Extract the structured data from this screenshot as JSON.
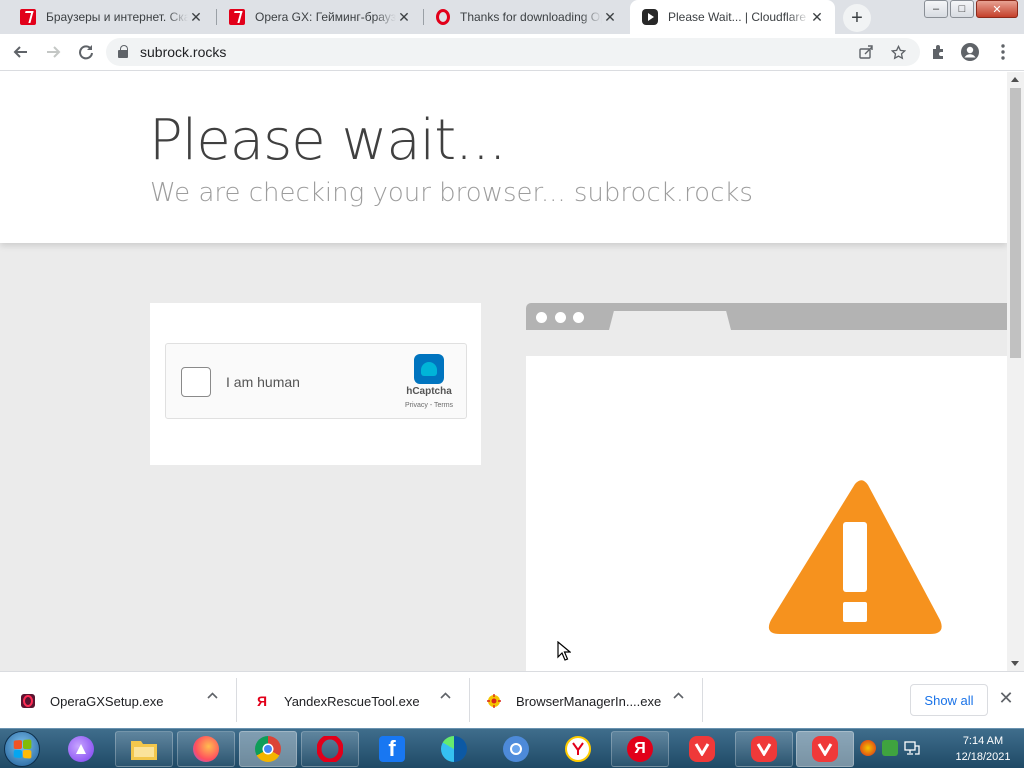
{
  "browser": {
    "tabs": [
      {
        "title": "Браузеры и интернет. Скачать",
        "favicon": "red-softportal-icon",
        "active": false
      },
      {
        "title": "Opera GX: Гейминг-браузер",
        "favicon": "red-softportal-icon",
        "active": false
      },
      {
        "title": "Thanks for downloading Opera",
        "favicon": "opera-icon",
        "active": false
      },
      {
        "title": "Please Wait... | Cloudflare",
        "favicon": "youtube-icon",
        "active": true
      }
    ],
    "new_tab_symbol": "+",
    "window_controls": {
      "minimize": "–",
      "maximize": "□",
      "close": "✕"
    },
    "address": "subrock.rocks",
    "toolbar_icons": [
      "back-icon",
      "forward-icon",
      "reload-icon",
      "lock-icon",
      "share-icon",
      "star-icon",
      "extensions-icon",
      "profile-icon",
      "menu-icon"
    ]
  },
  "page": {
    "heading": "Please wait...",
    "subheading": "We are checking your browser... subrock.rocks",
    "captcha": {
      "label": "I am human",
      "brand": "hCaptcha",
      "links": "Privacy - Terms"
    },
    "colors": {
      "warning": "#f6921e",
      "background": "#ebebeb"
    }
  },
  "downloads": {
    "items": [
      {
        "name": "OperaGXSetup.exe",
        "icon": "opera-gx-icon"
      },
      {
        "name": "YandexRescueTool.exe",
        "icon": "yandex-icon"
      },
      {
        "name": "BrowserManagerIn....exe",
        "icon": "browser-manager-icon"
      }
    ],
    "show_all": "Show all"
  },
  "taskbar": {
    "apps": [
      "alice-icon",
      "explorer-icon",
      "firefox-icon",
      "chrome-icon",
      "opera-icon",
      "facebook-icon",
      "edge-icon",
      "chromium-icon",
      "yandex-icon",
      "yandex-browser-icon",
      "vivaldi-icon",
      "vivaldi-icon",
      "vivaldi-icon"
    ],
    "time": "7:14 AM",
    "date": "12/18/2021",
    "yandex_letter": "Я",
    "facebook_letter": "f"
  }
}
